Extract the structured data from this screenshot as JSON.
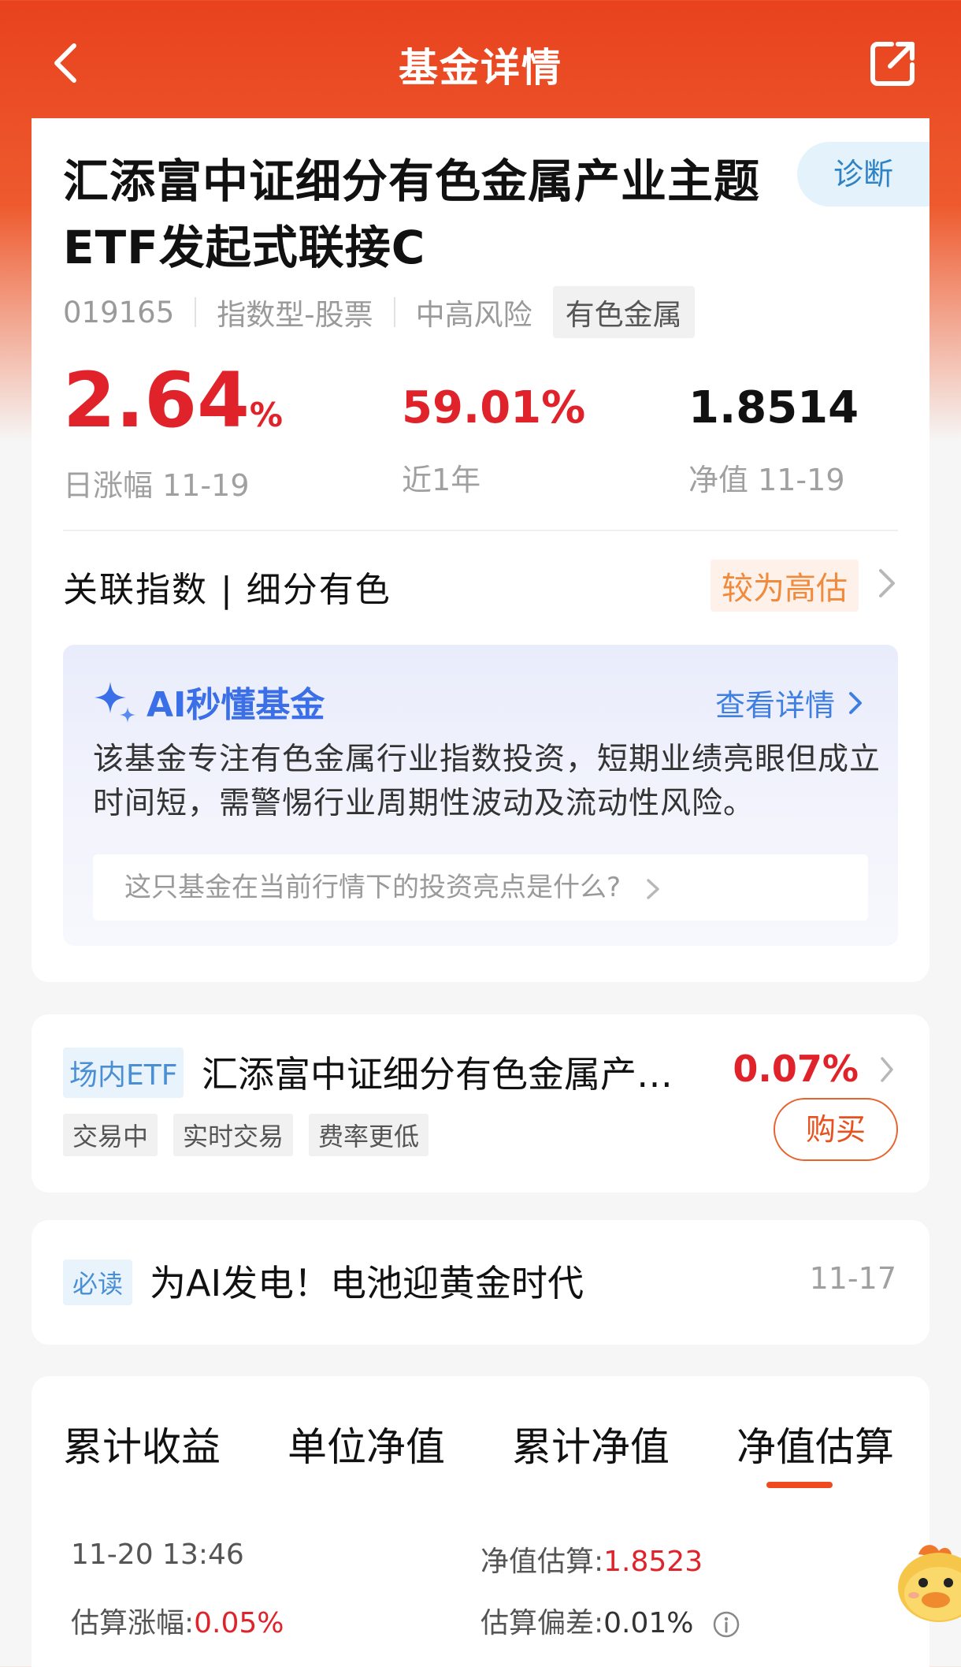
{
  "header": {
    "title": "基金详情",
    "back_icon": "chevron-left-icon",
    "share_icon": "share-external-icon"
  },
  "fund": {
    "name": "汇添富中证细分有色金属产业主题ETF发起式联接C",
    "diagnose_label": "诊断",
    "code": "019165",
    "type": "指数型-股票",
    "risk": "中高风险",
    "sector_tag": "有色金属"
  },
  "stats": {
    "day_change_value": "2.64",
    "day_change_unit": "%",
    "day_change_label": "日涨幅 11-19",
    "year_return_value": "59.01%",
    "year_return_label": "近1年",
    "nav_value": "1.8514",
    "nav_label": "净值 11-19"
  },
  "related_index": {
    "label": "关联指数 | 细分有色",
    "valuation": "较为高估"
  },
  "ai_box": {
    "title": "AI秒懂基金",
    "more_label": "查看详情",
    "summary": "该基金专注有色金属行业指数投资，短期业绩亮眼但成立时间短，需警惕行业周期性波动及流动性风险。",
    "question": "这只基金在当前行情下的投资亮点是什么?"
  },
  "etf": {
    "tag": "场内ETF",
    "name": "汇添富中证细分有色金属产…",
    "change": "0.07%",
    "tags": [
      "交易中",
      "实时交易",
      "费率更低"
    ],
    "buy_label": "购买"
  },
  "news": {
    "tag": "必读",
    "title": "为AI发电！电池迎黄金时代",
    "date": "11-17"
  },
  "tabs": {
    "items": [
      "累计收益",
      "单位净值",
      "累计净值",
      "净值估算"
    ],
    "active_index": 3
  },
  "estimate": {
    "time": "11-20 13:46",
    "est_nav_label": "净值估算:",
    "est_nav_value": "1.8523",
    "est_change_label": "估算涨幅:",
    "est_change_value": "0.05%",
    "est_deviation_label": "估算偏差:",
    "est_deviation_value": "0.01%"
  },
  "colors": {
    "brand": "#e8421e",
    "rise": "#e0232a",
    "link": "#3f7fe0"
  }
}
